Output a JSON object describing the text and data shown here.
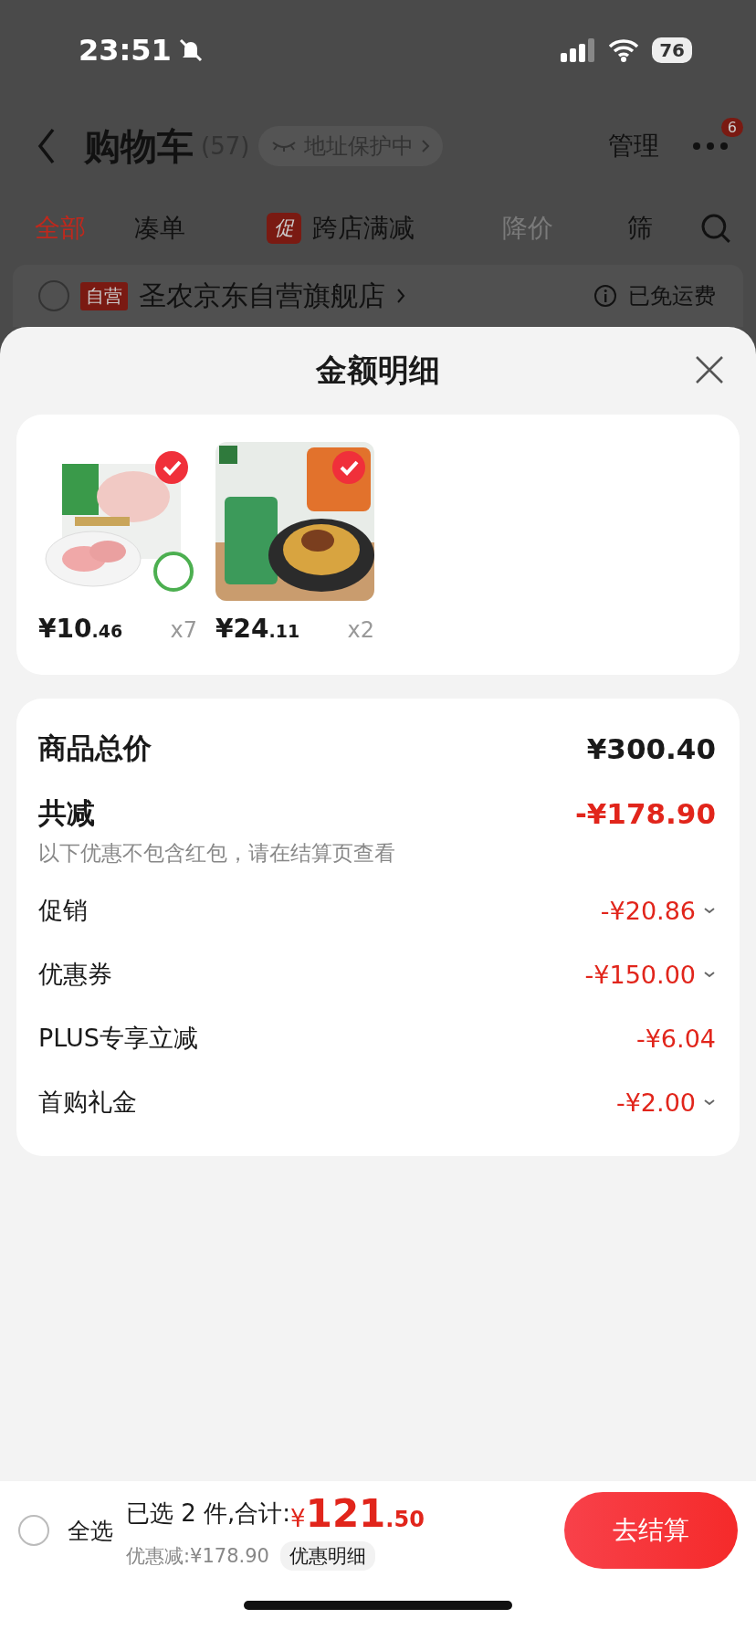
{
  "status_bar": {
    "time": "23:51",
    "battery": "76"
  },
  "nav": {
    "title": "购物车",
    "count": "(57)",
    "address_chip": "地址保护中",
    "manage": "管理",
    "more_badge": "6"
  },
  "tabs": [
    {
      "label": "全部",
      "selected": true,
      "faded": false
    },
    {
      "label": "凑单",
      "selected": false,
      "faded": false
    },
    {
      "label": "跨店满减",
      "badge": "促",
      "selected": false,
      "faded": false
    },
    {
      "label": "降价",
      "selected": false,
      "faded": true
    },
    {
      "label": "筛",
      "selected": false,
      "faded": false
    }
  ],
  "store": {
    "checked": false,
    "tag": "自营",
    "name": "圣农京东自营旗舰店",
    "shipping": "已免运费"
  },
  "sheet": {
    "title": "金额明细",
    "products": [
      {
        "kind": "chicken",
        "checked": true,
        "price_int": "¥10",
        "price_dec": ".46",
        "qty": "x7"
      },
      {
        "kind": "noodles",
        "checked": true,
        "price_int": "¥24",
        "price_dec": ".11",
        "qty": "x2"
      }
    ],
    "rows": [
      {
        "kind": "total",
        "label": "商品总价",
        "amount": "¥300.40"
      },
      {
        "kind": "saving",
        "label": "共减",
        "amount": "-¥178.90"
      },
      {
        "kind": "note",
        "label": "以下优惠不包含红包，请在结算页查看"
      },
      {
        "kind": "line",
        "label": "促销",
        "amount": "-¥20.86",
        "expandable": true
      },
      {
        "kind": "line",
        "label": "优惠券",
        "amount": "-¥150.00",
        "expandable": true
      },
      {
        "kind": "line",
        "label": "PLUS专享立减",
        "amount": "-¥6.04",
        "expandable": false
      },
      {
        "kind": "line",
        "label": "首购礼金",
        "amount": "-¥2.00",
        "expandable": true
      }
    ]
  },
  "bottom_bar": {
    "select_all": {
      "label": "全选",
      "checked": false
    },
    "selected_text": "已选 2 件,合计:",
    "total_symbol": "¥",
    "total_int": "121",
    "total_dec": ".50",
    "discount": "优惠减:¥178.90",
    "detail_chip": "优惠明细",
    "checkout": "去结算"
  }
}
